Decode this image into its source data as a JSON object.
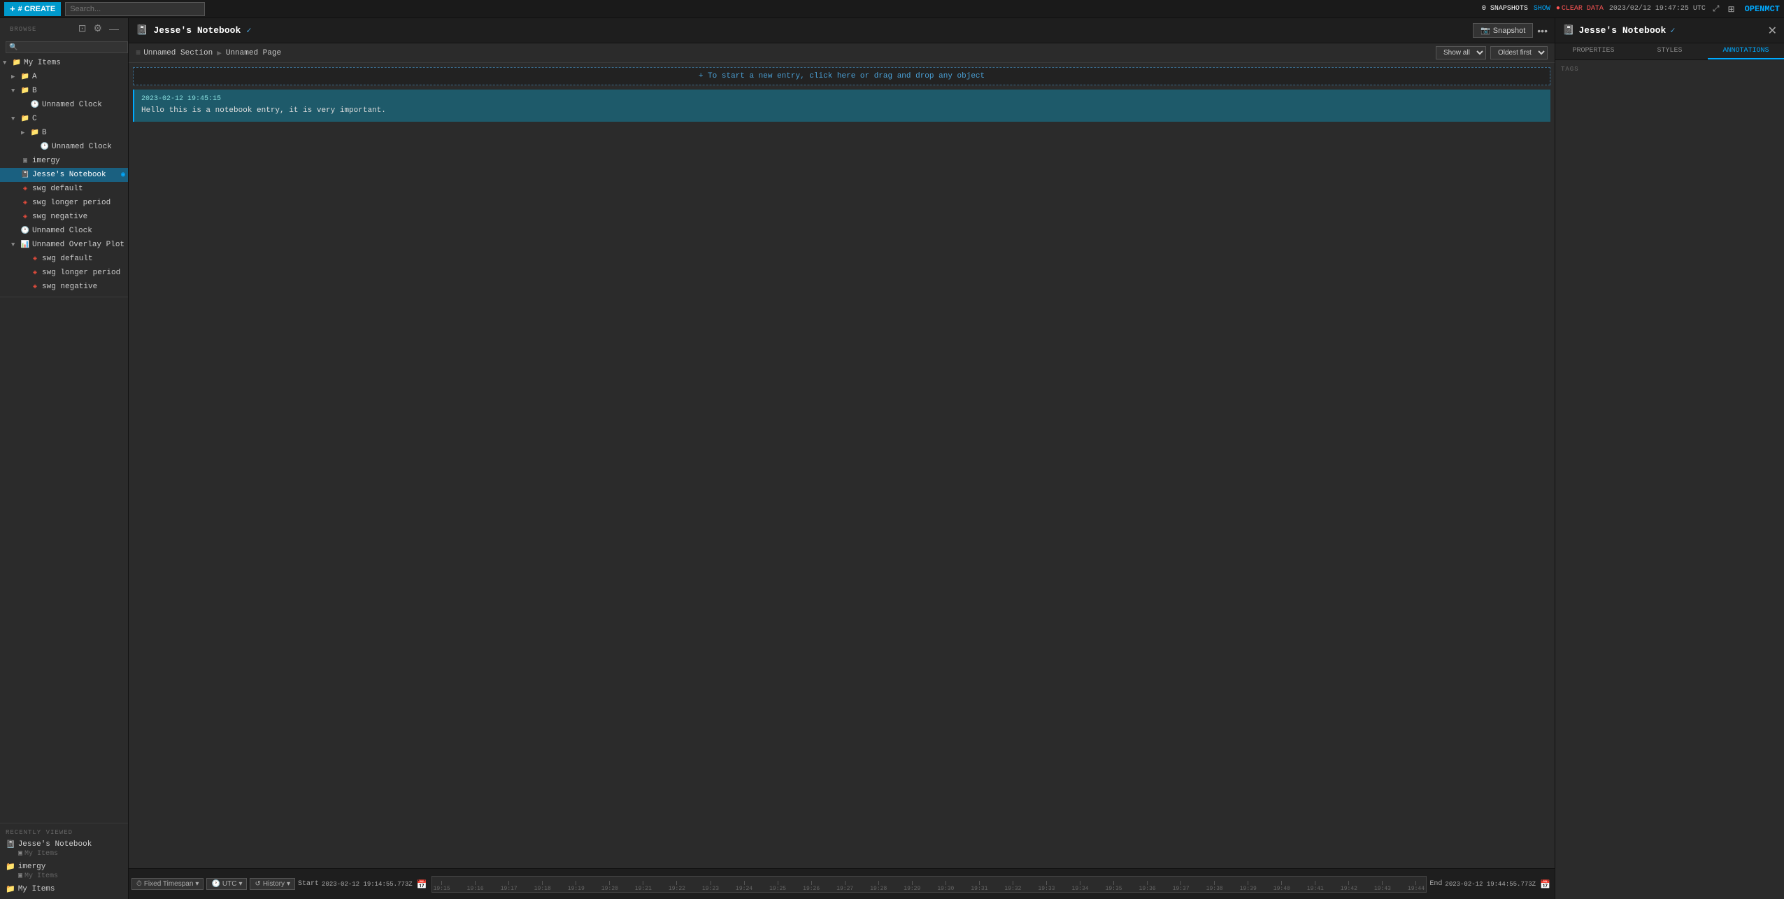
{
  "topbar": {
    "create_label": "# CREATE",
    "search_placeholder": "Search...",
    "snapshots_label": "0 SNAPSHOTS",
    "show_label": "SHOW",
    "clear_data_label": "CLEAR DATA",
    "timestamp": "2023/02/12 19:47:25 UTC",
    "logo": "OPENMCT"
  },
  "sidebar": {
    "browse_label": "BROWSE",
    "search_placeholder": "🔍",
    "tree": [
      {
        "id": "my-items",
        "label": "My Items",
        "type": "folder",
        "indent": 0,
        "expanded": true
      },
      {
        "id": "a",
        "label": "A",
        "type": "folder",
        "indent": 1,
        "expanded": false
      },
      {
        "id": "b-top",
        "label": "B",
        "type": "folder",
        "indent": 1,
        "expanded": true
      },
      {
        "id": "unnamed-clock-1",
        "label": "Unnamed Clock",
        "type": "clock",
        "indent": 2
      },
      {
        "id": "c",
        "label": "C",
        "type": "folder",
        "indent": 1,
        "expanded": true
      },
      {
        "id": "b-sub",
        "label": "B",
        "type": "folder",
        "indent": 2,
        "expanded": false
      },
      {
        "id": "unnamed-clock-2",
        "label": "Unnamed Clock",
        "type": "clock",
        "indent": 3
      },
      {
        "id": "imergy",
        "label": "imergy",
        "type": "folder-flat",
        "indent": 1
      },
      {
        "id": "jesses-notebook",
        "label": "Jesse's Notebook",
        "type": "notebook",
        "indent": 1,
        "active": true
      },
      {
        "id": "swg-default-1",
        "label": "swg default",
        "type": "swg",
        "indent": 1
      },
      {
        "id": "swg-longer-1",
        "label": "swg longer period",
        "type": "swg",
        "indent": 1
      },
      {
        "id": "swg-negative-1",
        "label": "swg negative",
        "type": "swg",
        "indent": 1
      },
      {
        "id": "unnamed-clock-3",
        "label": "Unnamed Clock",
        "type": "clock",
        "indent": 1
      },
      {
        "id": "unnamed-overlay",
        "label": "Unnamed Overlay Plot",
        "type": "overlay",
        "indent": 1,
        "expanded": true
      },
      {
        "id": "swg-default-2",
        "label": "swg default",
        "type": "swg-sub",
        "indent": 2
      },
      {
        "id": "swg-longer-2",
        "label": "swg longer period",
        "type": "swg-sub",
        "indent": 2
      },
      {
        "id": "swg-negative-2",
        "label": "swg negative",
        "type": "swg-sub",
        "indent": 2
      }
    ],
    "recently_viewed_label": "RECENTLY VIEWED",
    "recently_viewed": [
      {
        "id": "rv-jesses",
        "label": "Jesse's Notebook",
        "sub": "My Items",
        "type": "notebook"
      },
      {
        "id": "rv-imergy",
        "label": "imergy",
        "sub": "My Items",
        "type": "folder"
      },
      {
        "id": "rv-my-items",
        "label": "My Items",
        "type": "folder"
      }
    ]
  },
  "object_header": {
    "icon": "📓",
    "title": "Jesse's Notebook",
    "snapshot_btn": "Snapshot",
    "snapshot_icon": "📷"
  },
  "breadcrumb": {
    "section": "Unnamed Section",
    "page": "Unnamed Page",
    "show_all": "Show all",
    "oldest_first": "Oldest first"
  },
  "entries": [
    {
      "timestamp": "2023-02-12 19:45:15",
      "text": "Hello this is a notebook entry, it is very important."
    }
  ],
  "new_entry_prompt": "+ To start a new entry, click here or drag and drop any object",
  "timeline": {
    "mode_label": "Fixed Timespan",
    "utc_label": "UTC",
    "history_label": "History",
    "start_label": "Start",
    "start_time": "2023-02-12 19:14:55.773Z",
    "end_label": "End",
    "end_time": "2023-02-12 19:44:55.773Z",
    "ticks": [
      "19:15",
      "19:16",
      "19:17",
      "19:18",
      "19:19",
      "19:20",
      "19:21",
      "19:22",
      "19:23",
      "19:24",
      "19:25",
      "19:26",
      "19:27",
      "19:28",
      "19:29",
      "19:30",
      "19:31",
      "19:32",
      "19:33",
      "19:34",
      "19:35",
      "19:36",
      "19:37",
      "19:38",
      "19:39",
      "19:40",
      "19:41",
      "19:42",
      "19:43",
      "19:44"
    ]
  },
  "right_panel": {
    "icon": "📓",
    "title": "Jesse's Notebook",
    "tabs": [
      "PROPERTIES",
      "STYLES",
      "ANNOTATIONS"
    ],
    "active_tab": "ANNOTATIONS",
    "tags_label": "TAGS"
  }
}
